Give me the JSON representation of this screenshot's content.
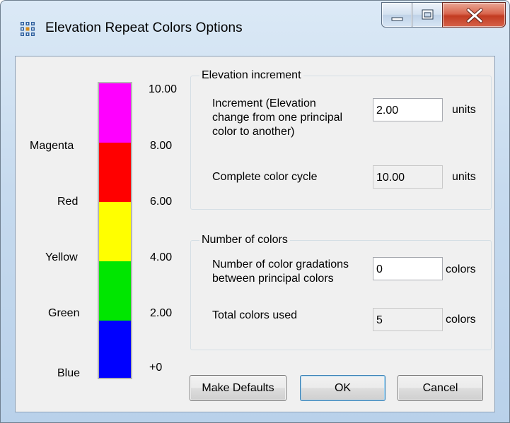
{
  "window": {
    "title": "Elevation Repeat Colors Options",
    "icon": "grid-dots-icon"
  },
  "caption_buttons": [
    {
      "name": "minimize",
      "icon": "minimize-icon"
    },
    {
      "name": "maximize",
      "icon": "maximize-icon"
    },
    {
      "name": "close",
      "icon": "close-x-icon"
    }
  ],
  "color_bar": {
    "segments": [
      {
        "color_name": "Magenta",
        "hex": "#ff00ff",
        "top_value": "10.00",
        "bottom_value": "8.00"
      },
      {
        "color_name": "Red",
        "hex": "#ff0000",
        "top_value": "8.00",
        "bottom_value": "6.00"
      },
      {
        "color_name": "Yellow",
        "hex": "#ffff00",
        "top_value": "6.00",
        "bottom_value": "4.00"
      },
      {
        "color_name": "Green",
        "hex": "#00e600",
        "top_value": "4.00",
        "bottom_value": "2.00"
      },
      {
        "color_name": "Blue",
        "hex": "#0000ff",
        "top_value": "2.00",
        "bottom_value": "+0"
      }
    ],
    "left_labels": [
      "Magenta",
      "Red",
      "Yellow",
      "Green",
      "Blue"
    ],
    "right_labels": [
      "10.00",
      "8.00",
      "6.00",
      "4.00",
      "2.00",
      "+0"
    ]
  },
  "elevation_increment": {
    "title": "Elevation increment",
    "increment_label_lines": [
      "Increment (Elevation",
      "change from one principal",
      "color to another)"
    ],
    "increment_value": "2.00",
    "increment_units": "units",
    "cycle_label": "Complete color cycle",
    "cycle_value": "10.00",
    "cycle_units": "units"
  },
  "number_of_colors": {
    "title": "Number of colors",
    "gradations_label_lines": [
      "Number of color gradations",
      "between principal colors"
    ],
    "gradations_value": "0",
    "gradations_units": "colors",
    "total_label": "Total colors used",
    "total_value": "5",
    "total_units": "colors"
  },
  "buttons": {
    "make_defaults": "Make Defaults",
    "ok": "OK",
    "cancel": "Cancel"
  }
}
